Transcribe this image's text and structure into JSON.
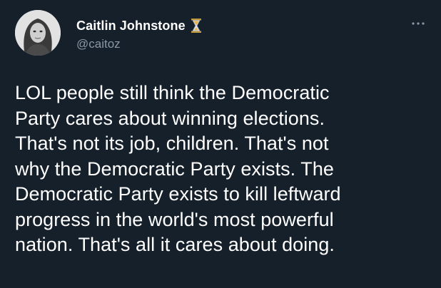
{
  "author": {
    "display_name": "Caitlin Johnstone",
    "handle": "@caitoz",
    "badge_icon": "hourglass-icon",
    "avatar_icon": "profile-photo"
  },
  "menu": {
    "icon": "more-options-icon",
    "glyph": "···"
  },
  "tweet": {
    "lines": [
      "LOL people still think the Democratic",
      "Party cares about winning elections.",
      "That's not its job, children. That's not",
      "why the Democratic Party exists. The",
      "Democratic Party exists to kill leftward",
      "progress in the world's most powerful",
      "nation. That's all it cares about doing."
    ]
  },
  "colors": {
    "background": "#15202b",
    "text": "#ffffff",
    "secondary_text": "#8b98a5"
  }
}
